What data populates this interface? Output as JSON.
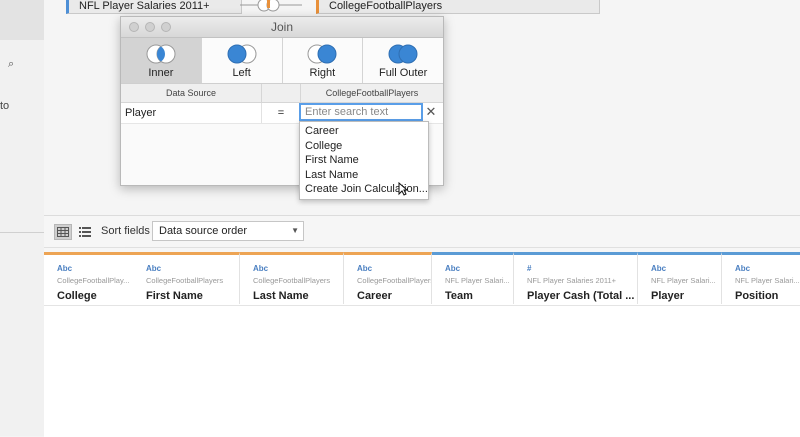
{
  "canvas": {
    "left_table": "NFL Player Salaries 2011+",
    "right_table": "CollegeFootballPlayers",
    "left_color": "#4d8fd6",
    "right_color": "#e8903a"
  },
  "join_dialog": {
    "title": "Join",
    "join_types": [
      {
        "label": "Inner",
        "icon": "inner-join-icon",
        "active": true
      },
      {
        "label": "Left",
        "icon": "left-join-icon",
        "active": false
      },
      {
        "label": "Right",
        "icon": "right-join-icon",
        "active": false
      },
      {
        "label": "Full Outer",
        "icon": "full-outer-join-icon",
        "active": false
      }
    ],
    "header": {
      "left": "Data Source",
      "right": "CollegeFootballPlayers"
    },
    "clause": {
      "left_field": "Player",
      "operator": "="
    },
    "search": {
      "placeholder": "Enter search text",
      "value": ""
    },
    "field_options": [
      "Career",
      "College",
      "First Name",
      "Last Name",
      "Create Join Calculation..."
    ]
  },
  "left_panel": {
    "text_fragment": "to"
  },
  "toolbar": {
    "sort_label": "Sort fields",
    "sort_value": "Data source order"
  },
  "grid": {
    "columns": [
      {
        "type": "Abc",
        "source": "CollegeFootballPlay...",
        "name": "College",
        "table": "college"
      },
      {
        "type": "Abc",
        "source": "CollegeFootballPlayers",
        "name": "First Name",
        "table": "college"
      },
      {
        "type": "Abc",
        "source": "CollegeFootballPlayers",
        "name": "Last Name",
        "table": "college"
      },
      {
        "type": "Abc",
        "source": "CollegeFootballPlayers",
        "name": "Career",
        "table": "college"
      },
      {
        "type": "Abc",
        "source": "NFL Player Salari...",
        "name": "Team",
        "table": "nfl"
      },
      {
        "type": "#",
        "source": "NFL Player Salaries 2011+",
        "name": "Player Cash (Total ...",
        "table": "nfl"
      },
      {
        "type": "Abc",
        "source": "NFL Player Salari...",
        "name": "Player",
        "table": "nfl"
      },
      {
        "type": "Abc",
        "source": "NFL Player Salari...",
        "name": "Position",
        "table": "nfl"
      }
    ]
  },
  "colors": {
    "accent_blue": "#5a9ee8",
    "join_blue": "#3a86d4"
  }
}
